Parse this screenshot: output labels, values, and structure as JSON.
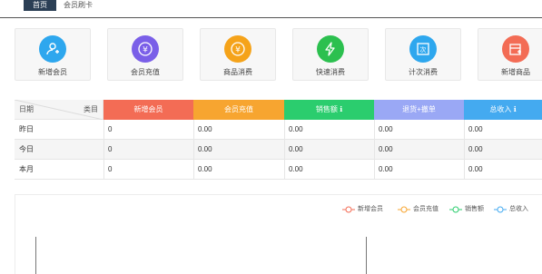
{
  "tabs": [
    {
      "label": "首页",
      "active": true
    },
    {
      "label": "会员刷卡",
      "active": false
    }
  ],
  "actions": [
    {
      "label": "新增会员",
      "icon": "add-member-icon",
      "color": "#2ea7ee"
    },
    {
      "label": "会员充值",
      "icon": "yen-recharge-icon",
      "color": "#7a5fe8"
    },
    {
      "label": "商品消费",
      "icon": "yen-coin-icon",
      "color": "#f5a31a"
    },
    {
      "label": "快速消费",
      "icon": "lightning-icon",
      "color": "#2cc04f"
    },
    {
      "label": "计次消费",
      "icon": "count-card-icon",
      "color": "#2ea7ee"
    },
    {
      "label": "新增商品",
      "icon": "add-product-icon",
      "color": "#f36c55"
    }
  ],
  "table": {
    "corner_left": "日期",
    "corner_right": "类目",
    "columns": [
      {
        "label": "新增会员",
        "color": "#f36c55"
      },
      {
        "label": "会员充值",
        "color": "#f7a530"
      },
      {
        "label": "销售额 ℹ",
        "color": "#2bcd6e"
      },
      {
        "label": "退货+撤单",
        "color": "#9aa8f5"
      },
      {
        "label": "总收入 ℹ",
        "color": "#44aaf0"
      }
    ],
    "rows": [
      {
        "label": "昨日",
        "values": [
          "0",
          "0.00",
          "0.00",
          "0.00",
          "0.00"
        ]
      },
      {
        "label": "今日",
        "values": [
          "0",
          "0.00",
          "0.00",
          "0.00",
          "0.00"
        ]
      },
      {
        "label": "本月",
        "values": [
          "0",
          "0.00",
          "0.00",
          "0.00",
          "0.00"
        ]
      }
    ]
  },
  "legend": [
    {
      "label": "新增会员",
      "color": "#f36c55"
    },
    {
      "label": "会员充值",
      "color": "#f7a530"
    },
    {
      "label": "销售额",
      "color": "#2bcd6e"
    },
    {
      "label": "总收入",
      "color": "#44aaf0"
    }
  ]
}
